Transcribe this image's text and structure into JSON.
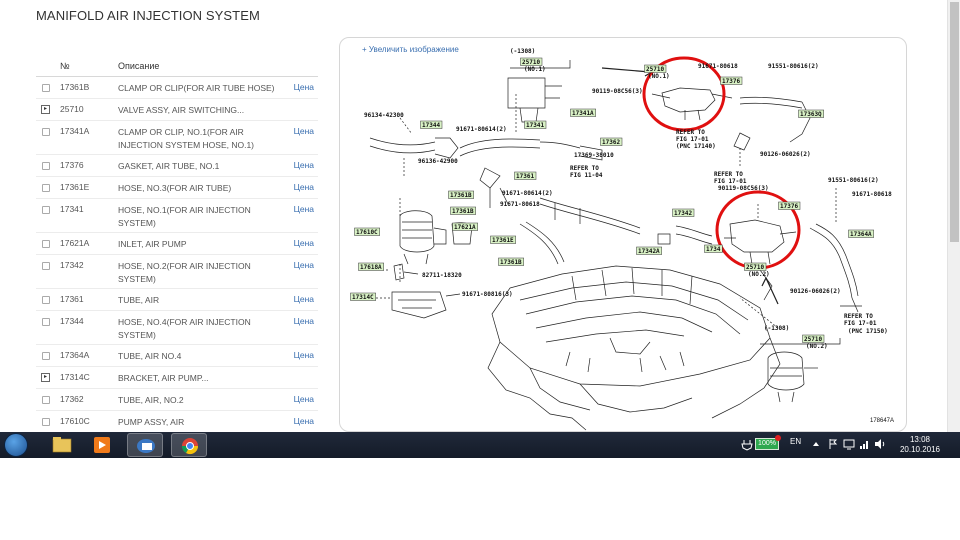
{
  "page_title": "MANIFOLD AIR INJECTION SYSTEM",
  "table": {
    "col_number": "№",
    "col_description": "Описание",
    "rows": [
      {
        "number": "17361B",
        "description": "CLAMP OR CLIP(FOR AIR TUBE HOSE)",
        "price": "Цена",
        "expandable": false
      },
      {
        "number": "25710",
        "description": "VALVE ASSY, AIR SWITCHING...",
        "price": "",
        "expandable": true
      },
      {
        "number": "17341A",
        "description": "CLAMP OR CLIP, NO.1(FOR AIR INJECTION SYSTEM HOSE, NO.1)",
        "price": "Цена",
        "expandable": false
      },
      {
        "number": "17376",
        "description": "GASKET, AIR TUBE, NO.1",
        "price": "Цена",
        "expandable": false
      },
      {
        "number": "17361E",
        "description": "HOSE, NO.3(FOR AIR TUBE)",
        "price": "Цена",
        "expandable": false
      },
      {
        "number": "17341",
        "description": "HOSE, NO.1(FOR AIR INJECTION SYSTEM)",
        "price": "Цена",
        "expandable": false
      },
      {
        "number": "17621A",
        "description": "INLET, AIR PUMP",
        "price": "Цена",
        "expandable": false
      },
      {
        "number": "17342",
        "description": "HOSE, NO.2(FOR AIR INJECTION SYSTEM)",
        "price": "Цена",
        "expandable": false
      },
      {
        "number": "17361",
        "description": "TUBE, AIR",
        "price": "Цена",
        "expandable": false
      },
      {
        "number": "17344",
        "description": "HOSE, NO.4(FOR AIR INJECTION SYSTEM)",
        "price": "Цена",
        "expandable": false
      },
      {
        "number": "17364A",
        "description": "TUBE, AIR NO.4",
        "price": "Цена",
        "expandable": false
      },
      {
        "number": "17314C",
        "description": "BRACKET, AIR PUMP...",
        "price": "",
        "expandable": true
      },
      {
        "number": "17362",
        "description": "TUBE, AIR, NO.2",
        "price": "Цена",
        "expandable": false
      },
      {
        "number": "17610C",
        "description": "PUMP ASSY, AIR",
        "price": "Цена",
        "expandable": false
      }
    ]
  },
  "diagram": {
    "zoom_link": "+ Увеличить изображение",
    "figure_id": "178647A",
    "labels": {
      "l1308a": "(-1308)",
      "l25710a": "25710",
      "lno1a": "(NO.1)",
      "l25710b": "25710",
      "lno1b": "(NO.1)",
      "l90119a": "90119-08C56(3)",
      "l91671a": "91671-80618",
      "l91551a": "91551-80616(2)",
      "l17376a": "17376",
      "l17363q": "17363Q",
      "lrefer1": "REFER TO",
      "lfig1": "FIG 17-01",
      "lpnc1": "(PNC 17140)",
      "l90126a": "90126-06026(2)",
      "lrefer2": "REFER TO",
      "lfig2": "FIG 17-01",
      "l96134a": "96134-42300",
      "l17344": "17344",
      "l91671b": "91671-80614(2)",
      "l17341": "17341",
      "l17341a": "17341A",
      "l96136": "96136-42900",
      "l17362": "17362",
      "l17369": "17369-38010",
      "lrefer3": "REFER TO",
      "lfig3": "FIG 11-04",
      "l17361": "17361",
      "l17361b": "17361B",
      "l91671c": "91671-80614(2)",
      "l91671d": "91671-80618",
      "l17361b2": "17361B",
      "l17610c": "17610C",
      "l17621a": "17621A",
      "l17361e": "17361E",
      "l17342": "17342",
      "l17342a": "17342A",
      "l17361b3": "17361B",
      "l17618a": "17618A",
      "l82711": "82711-18320",
      "l17314c": "17314C",
      "l91671e": "91671-80816(3)",
      "l90119b": "90119-08C56(3)",
      "l91551b": "91551-80616(2)",
      "l91671f": "91671-80618",
      "l17376b": "17376",
      "l17364a": "17364A",
      "l17344b": "1734",
      "l25710c": "25710",
      "lno2a": "(NO.2)",
      "l90126b": "90126-06026(2)",
      "lrefer4": "REFER TO",
      "lfig4": "FIG 17-01",
      "lpnc4": "(PNC 17150)",
      "l1308b": "(-1308)",
      "l25710d": "25710",
      "lno2b": "(NO.2)"
    }
  },
  "taskbar": {
    "battery": "100%",
    "language": "EN",
    "time": "13:08",
    "date": "20.10.2016"
  },
  "colors": {
    "link": "#3a6fb0",
    "highlight_circle": "#e01010",
    "label_bg": "#d9f2c6",
    "taskbar": "#1a2232"
  },
  "icons": {
    "start": "windows-start-icon",
    "apps": [
      "file-explorer-icon",
      "media-player-icon",
      "outlook-icon",
      "chrome-icon"
    ],
    "tray": [
      "battery-icon",
      "arrow-up-icon",
      "flag-icon",
      "speaker-icon",
      "network-icon",
      "screen-icon"
    ]
  }
}
